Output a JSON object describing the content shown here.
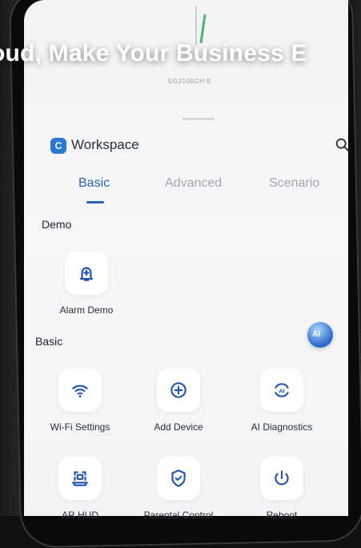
{
  "headline": "oud, Make Your Business E",
  "device": {
    "model": "EG3100GH-E"
  },
  "app": {
    "logo_letter": "C",
    "title": "Workspace"
  },
  "tabs": [
    "Basic",
    "Advanced",
    "Scenario"
  ],
  "active_tab": "Basic",
  "sections": {
    "demo": {
      "label": "Demo",
      "items": [
        {
          "label": "Alarm Demo",
          "icon": "alarm-bell-icon"
        }
      ]
    },
    "basic": {
      "label": "Basic",
      "items": [
        {
          "label": "Wi-Fi Settings",
          "icon": "wifi-icon"
        },
        {
          "label": "Add Device",
          "icon": "add-circle-icon"
        },
        {
          "label": "AI Diagnostics",
          "icon": "ai-diagnostics-icon"
        },
        {
          "label": "AR HUD",
          "icon": "ar-hud-icon"
        },
        {
          "label": "Parental Control",
          "icon": "shield-check-icon"
        },
        {
          "label": "Reboot",
          "icon": "power-icon"
        }
      ]
    }
  },
  "ai_badge_text": "AI",
  "colors": {
    "accent": "#2f5fb5",
    "logo": "#2a79d1",
    "icon_blue": "#1f56b3"
  }
}
